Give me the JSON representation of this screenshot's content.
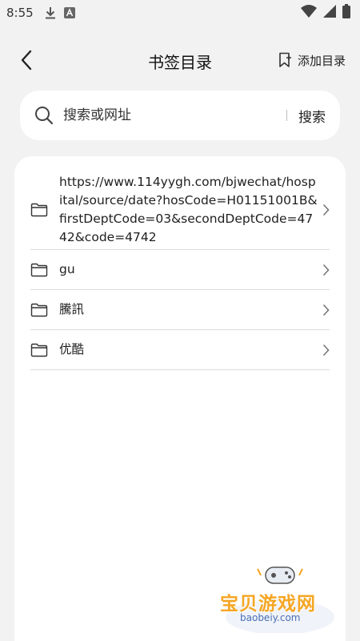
{
  "status_bar": {
    "time": "8:55"
  },
  "header": {
    "title": "书签目录",
    "add_label": "添加目录"
  },
  "search": {
    "placeholder": "搜索或网址",
    "button_label": "搜索"
  },
  "bookmarks": [
    {
      "label": "https://www.114yygh.com/bjwechat/hospital/source/date?hosCode=H01151001B&firstDeptCode=03&secondDeptCode=4742&code=4742"
    },
    {
      "label": "gu"
    },
    {
      "label": "騰訊"
    },
    {
      "label": "优酷"
    }
  ],
  "watermark": {
    "text": "宝贝游戏网",
    "url": "baobeiy.com"
  },
  "colors": {
    "background": "#f2f2f2",
    "card": "#ffffff",
    "divider": "#dcdcdc",
    "watermark": "#f5a623"
  }
}
